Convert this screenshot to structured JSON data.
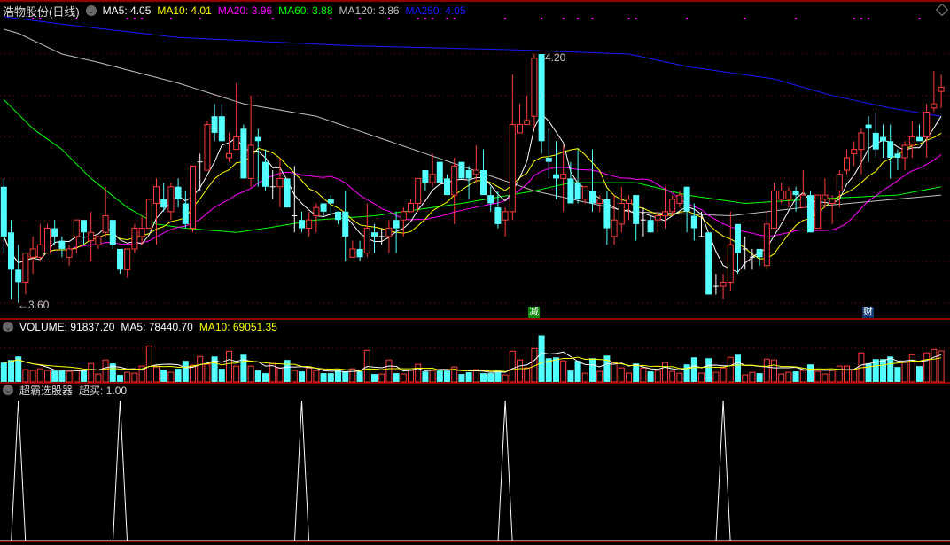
{
  "price_header": {
    "title": "浩物股份(日线)",
    "ma5": "MA5: 4.05",
    "ma10": "MA10: 4.01",
    "ma20": "MA20: 3.96",
    "ma60": "MA60: 3.88",
    "ma120": "MA120: 3.86",
    "ma250": "MA250: 4.05"
  },
  "volume_header": {
    "volume": "VOLUME: 91837.20",
    "ma5": "MA5: 78440.70",
    "ma10": "MA10: 69051.35"
  },
  "indicator_header": {
    "name": "超霸选股器",
    "value": "超买: 1.00"
  },
  "annotations": {
    "high_label": "4.20",
    "low_label": "←3.60",
    "marker_jian": "减",
    "marker_cai": "财"
  },
  "colors": {
    "up": "#ff3c3c",
    "down": "#54ffff",
    "doji": "#ffffff",
    "ma5": "#ffffff",
    "ma10": "#ffff00",
    "ma20": "#ff00ff",
    "ma60": "#00ff00",
    "ma120": "#c0c0c0",
    "ma250": "#1a1aff",
    "grid": "#8a0000",
    "separator": "#c00000"
  },
  "chart_data": {
    "type": "candlestick",
    "price_grid": [
      4.2,
      4.1,
      4.0,
      3.9,
      3.8,
      3.7,
      3.6
    ],
    "candles": [
      [
        3.88,
        3.76,
        3.9,
        3.72
      ],
      [
        3.77,
        3.68,
        3.8,
        3.61
      ],
      [
        3.68,
        3.65,
        3.74,
        3.6
      ],
      [
        3.65,
        3.72,
        3.72,
        3.62
      ],
      [
        3.71,
        3.73,
        3.76,
        3.67
      ],
      [
        3.71,
        3.74,
        3.79,
        3.7
      ],
      [
        3.72,
        3.78,
        3.79,
        3.72
      ],
      [
        3.78,
        3.76,
        3.8,
        3.74
      ],
      [
        3.75,
        3.73,
        3.76,
        3.71
      ],
      [
        3.71,
        3.73,
        3.74,
        3.69
      ],
      [
        3.76,
        3.8,
        3.8,
        3.72
      ],
      [
        3.8,
        3.77,
        3.8,
        3.74
      ],
      [
        3.75,
        3.77,
        3.82,
        3.7
      ],
      [
        3.74,
        3.76,
        3.76,
        3.73
      ],
      [
        3.77,
        3.81,
        3.88,
        3.76
      ],
      [
        3.8,
        3.74,
        3.8,
        3.73
      ],
      [
        3.73,
        3.68,
        3.73,
        3.67
      ],
      [
        3.68,
        3.73,
        3.73,
        3.66
      ],
      [
        3.73,
        3.78,
        3.79,
        3.72
      ],
      [
        3.76,
        3.78,
        3.81,
        3.74
      ],
      [
        3.78,
        3.85,
        3.85,
        3.78
      ],
      [
        3.84,
        3.88,
        3.9,
        3.74
      ],
      [
        3.85,
        3.83,
        3.89,
        3.82
      ],
      [
        3.82,
        3.88,
        3.89,
        3.8
      ],
      [
        3.88,
        3.85,
        3.9,
        3.83
      ],
      [
        3.84,
        3.79,
        3.87,
        3.78
      ],
      [
        3.78,
        3.93,
        3.93,
        3.77
      ],
      [
        3.94,
        3.94,
        3.96,
        3.87
      ],
      [
        3.92,
        4.03,
        4.04,
        3.92
      ],
      [
        4.05,
        4.01,
        4.08,
        3.99
      ],
      [
        4.05,
        3.99,
        4.08,
        3.99
      ],
      [
        3.95,
        3.96,
        4.01,
        3.94
      ],
      [
        3.97,
        4.0,
        4.13,
        3.97
      ],
      [
        4.02,
        3.9,
        4.03,
        3.9
      ],
      [
        3.9,
        3.98,
        4.1,
        3.88
      ],
      [
        4.0,
        3.99,
        4.02,
        3.88
      ],
      [
        3.94,
        3.88,
        3.97,
        3.87
      ],
      [
        3.88,
        3.88,
        3.92,
        3.85
      ],
      [
        3.88,
        3.9,
        3.95,
        3.83
      ],
      [
        3.9,
        3.83,
        3.9,
        3.83
      ],
      [
        3.81,
        3.81,
        3.93,
        3.77
      ],
      [
        3.8,
        3.78,
        3.82,
        3.77
      ],
      [
        3.78,
        3.8,
        3.82,
        3.76
      ],
      [
        3.81,
        3.83,
        3.84,
        3.77
      ],
      [
        3.84,
        3.82,
        3.84,
        3.81
      ],
      [
        3.85,
        3.84,
        3.86,
        3.81
      ],
      [
        3.82,
        3.8,
        3.82,
        3.79
      ],
      [
        3.82,
        3.76,
        3.87,
        3.7
      ],
      [
        3.71,
        3.73,
        3.75,
        3.71
      ],
      [
        3.73,
        3.71,
        3.75,
        3.7
      ],
      [
        3.72,
        3.78,
        3.84,
        3.71
      ],
      [
        3.77,
        3.76,
        3.79,
        3.72
      ],
      [
        3.76,
        3.76,
        3.78,
        3.74
      ],
      [
        3.76,
        3.78,
        3.8,
        3.72
      ],
      [
        3.8,
        3.78,
        3.82,
        3.72
      ],
      [
        3.8,
        3.82,
        3.83,
        3.76
      ],
      [
        3.82,
        3.84,
        3.85,
        3.82
      ],
      [
        3.84,
        3.9,
        3.9,
        3.82
      ],
      [
        3.92,
        3.89,
        3.92,
        3.87
      ],
      [
        3.89,
        3.91,
        3.96,
        3.88
      ],
      [
        3.94,
        3.89,
        3.94,
        3.89
      ],
      [
        3.9,
        3.86,
        3.91,
        3.86
      ],
      [
        3.86,
        3.93,
        3.95,
        3.79
      ],
      [
        3.94,
        3.9,
        3.94,
        3.9
      ],
      [
        3.92,
        3.9,
        3.93,
        3.85
      ],
      [
        3.91,
        3.92,
        3.98,
        3.89
      ],
      [
        3.92,
        3.86,
        3.97,
        3.86
      ],
      [
        3.86,
        3.84,
        3.88,
        3.82
      ],
      [
        3.83,
        3.79,
        3.87,
        3.78
      ],
      [
        3.8,
        3.82,
        3.83,
        3.76
      ],
      [
        3.82,
        4.03,
        4.15,
        3.8
      ],
      [
        4.01,
        4.03,
        4.08,
        4.01
      ],
      [
        4.03,
        4.04,
        4.1,
        4.03
      ],
      [
        4.05,
        4.19,
        4.2,
        4.02
      ],
      [
        4.2,
        3.99,
        4.2,
        3.96
      ],
      [
        3.95,
        3.94,
        4.02,
        3.9
      ],
      [
        3.91,
        3.9,
        3.99,
        3.85
      ],
      [
        3.9,
        3.91,
        3.98,
        3.82
      ],
      [
        3.9,
        3.84,
        3.94,
        3.84
      ],
      [
        3.89,
        3.85,
        3.97,
        3.84
      ],
      [
        3.85,
        3.88,
        3.88,
        3.84
      ],
      [
        3.87,
        3.84,
        3.97,
        3.82
      ],
      [
        3.84,
        3.85,
        3.86,
        3.82
      ],
      [
        3.85,
        3.78,
        3.87,
        3.74
      ],
      [
        3.76,
        3.8,
        3.86,
        3.74
      ],
      [
        3.79,
        3.84,
        3.88,
        3.77
      ],
      [
        3.84,
        3.85,
        3.86,
        3.8
      ],
      [
        3.86,
        3.79,
        3.86,
        3.75
      ],
      [
        3.8,
        3.8,
        3.83,
        3.76
      ],
      [
        3.8,
        3.77,
        3.81,
        3.77
      ],
      [
        3.8,
        3.81,
        3.82,
        3.77
      ],
      [
        3.81,
        3.82,
        3.88,
        3.78
      ],
      [
        3.82,
        3.85,
        3.86,
        3.81
      ],
      [
        3.84,
        3.86,
        3.87,
        3.83
      ],
      [
        3.88,
        3.82,
        3.88,
        3.77
      ],
      [
        3.81,
        3.78,
        3.84,
        3.75
      ],
      [
        3.76,
        3.76,
        3.82,
        3.76
      ],
      [
        3.77,
        3.62,
        3.77,
        3.62
      ],
      [
        3.64,
        3.64,
        3.67,
        3.62
      ],
      [
        3.64,
        3.65,
        3.67,
        3.61
      ],
      [
        3.65,
        3.74,
        3.82,
        3.63
      ],
      [
        3.79,
        3.72,
        3.79,
        3.67
      ],
      [
        3.73,
        3.73,
        3.76,
        3.68
      ],
      [
        3.71,
        3.71,
        3.73,
        3.68
      ],
      [
        3.73,
        3.71,
        3.73,
        3.69
      ],
      [
        3.69,
        3.79,
        3.82,
        3.68
      ],
      [
        3.78,
        3.87,
        3.89,
        3.78
      ],
      [
        3.85,
        3.87,
        3.89,
        3.84
      ],
      [
        3.85,
        3.87,
        3.88,
        3.83
      ],
      [
        3.87,
        3.86,
        3.88,
        3.82
      ],
      [
        3.83,
        3.86,
        3.92,
        3.83
      ],
      [
        3.86,
        3.77,
        3.87,
        3.77
      ],
      [
        3.78,
        3.86,
        3.86,
        3.78
      ],
      [
        3.85,
        3.86,
        3.9,
        3.83
      ],
      [
        3.84,
        3.85,
        3.86,
        3.79
      ],
      [
        3.87,
        3.91,
        3.92,
        3.83
      ],
      [
        3.92,
        3.95,
        3.97,
        3.91
      ],
      [
        3.96,
        3.97,
        3.99,
        3.93
      ],
      [
        3.97,
        4.01,
        4.02,
        3.91
      ],
      [
        4.03,
        4.02,
        4.05,
        3.94
      ],
      [
        4.01,
        3.97,
        4.06,
        3.95
      ],
      [
        4.0,
        3.99,
        4.03,
        3.95
      ],
      [
        3.99,
        3.95,
        4.03,
        3.9
      ],
      [
        3.96,
        3.95,
        3.97,
        3.92
      ],
      [
        3.95,
        3.98,
        3.99,
        3.92
      ],
      [
        3.98,
        4.0,
        4.04,
        3.95
      ],
      [
        4.0,
        3.99,
        4.03,
        3.99
      ],
      [
        4.0,
        4.06,
        4.08,
        3.95
      ],
      [
        4.07,
        4.08,
        4.16,
        4.06
      ],
      [
        4.11,
        4.12,
        4.15,
        4.07
      ]
    ],
    "ma60_points": [
      [
        1,
        4.09
      ],
      [
        5,
        4.02
      ],
      [
        9,
        3.97
      ],
      [
        13,
        3.9
      ],
      [
        18,
        3.83
      ],
      [
        22,
        3.79
      ],
      [
        26,
        3.78
      ],
      [
        33,
        3.77
      ],
      [
        37,
        3.78
      ],
      [
        44,
        3.8
      ],
      [
        52,
        3.81
      ],
      [
        64,
        3.84
      ],
      [
        74,
        3.87
      ],
      [
        79,
        3.89
      ],
      [
        88,
        3.89
      ],
      [
        95,
        3.86
      ],
      [
        103,
        3.84
      ],
      [
        112,
        3.85
      ],
      [
        124,
        3.86
      ],
      [
        130,
        3.88
      ]
    ],
    "ma120_points": [
      [
        1,
        4.26
      ],
      [
        3,
        4.25
      ],
      [
        9,
        4.2
      ],
      [
        14,
        4.18
      ],
      [
        25,
        4.13
      ],
      [
        34,
        4.08
      ],
      [
        44,
        4.05
      ],
      [
        59,
        3.96
      ],
      [
        74,
        3.87
      ],
      [
        87,
        3.82
      ],
      [
        101,
        3.81
      ],
      [
        111,
        3.83
      ],
      [
        130,
        3.86
      ]
    ],
    "ma250_points": [
      [
        1,
        4.29
      ],
      [
        10,
        4.27
      ],
      [
        25,
        4.24
      ],
      [
        49,
        4.22
      ],
      [
        72,
        4.21
      ],
      [
        87,
        4.2
      ],
      [
        95,
        4.17
      ],
      [
        107,
        4.14
      ],
      [
        115,
        4.1
      ],
      [
        123,
        4.07
      ],
      [
        130,
        4.05
      ]
    ],
    "volume_grid": 100000,
    "volumes": [
      57200,
      65000,
      75400,
      36400,
      33800,
      39000,
      33800,
      33800,
      33800,
      31200,
      33800,
      33800,
      54600,
      23400,
      65000,
      54600,
      20800,
      28600,
      26000,
      46800,
      106600,
      44200,
      36400,
      28600,
      39000,
      62400,
      49400,
      75400,
      52000,
      75400,
      39000,
      91000,
      46800,
      80600,
      46800,
      33800,
      26000,
      54600,
      41600,
      65000,
      33800,
      31200,
      41600,
      33800,
      26000,
      26000,
      33800,
      31200,
      39000,
      31200,
      93600,
      23400,
      23400,
      65000,
      26000,
      23400,
      33800,
      52000,
      31200,
      33800,
      33800,
      33800,
      44200,
      23400,
      28600,
      36400,
      26000,
      26000,
      33800,
      20800,
      91000,
      65000,
      41600,
      98800,
      137800,
      70200,
      72800,
      62400,
      33800,
      62400,
      26000,
      70200,
      31200,
      78000,
      57200,
      41600,
      26000,
      54600,
      41600,
      31200,
      33800,
      57200,
      31200,
      26000,
      52000,
      72800,
      26000,
      70200,
      28600,
      41600,
      72800,
      80600,
      20800,
      28600,
      26000,
      67600,
      65000,
      23400,
      28600,
      31200,
      33800,
      52000,
      31200,
      23400,
      33800,
      46800,
      46800,
      36400,
      85800,
      54600,
      67600,
      67600,
      75400,
      44200,
      57200,
      80600,
      46800,
      85800,
      96200,
      91837.2
    ],
    "signal_days": [
      5,
      6,
      11,
      18,
      19,
      20,
      24,
      28,
      38,
      46,
      50,
      54,
      58,
      59,
      60,
      62,
      63,
      70,
      75,
      78,
      80,
      82,
      87,
      88,
      95,
      103,
      110,
      118,
      119,
      120,
      127
    ],
    "indicator_spikes": [
      3,
      17,
      42,
      70,
      100
    ],
    "high_index": 75,
    "low_index": 3
  }
}
